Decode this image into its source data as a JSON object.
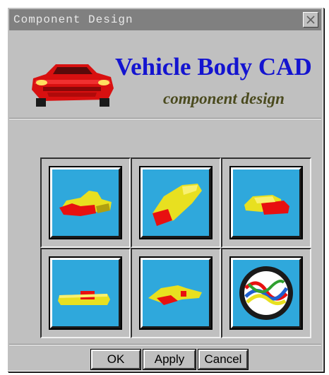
{
  "window": {
    "title": "Component Design",
    "close_icon": "close-icon"
  },
  "header": {
    "app_title": "Vehicle Body CAD",
    "subtitle": "component design",
    "logo_icon": "red-sports-car-icon"
  },
  "components": [
    {
      "icon": "car-body-side-component-icon"
    },
    {
      "icon": "car-roof-shell-component-icon"
    },
    {
      "icon": "rear-section-component-icon"
    },
    {
      "icon": "floor-panel-component-icon"
    },
    {
      "icon": "body-frame-component-icon"
    },
    {
      "icon": "wiring-emblem-component-icon"
    }
  ],
  "buttons": {
    "ok": "OK",
    "apply": "Apply",
    "cancel": "Cancel"
  },
  "colors": {
    "title_blue": "#1414d0",
    "subtitle_olive": "#4a4a1e",
    "tile_background": "#2fa8dc",
    "part_yellow": "#e8e020",
    "part_red": "#e81010"
  }
}
